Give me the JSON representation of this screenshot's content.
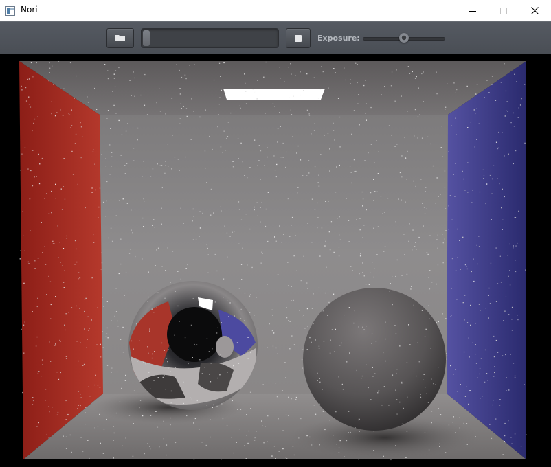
{
  "window": {
    "title": "Nori",
    "app_icon": "window-app-icon",
    "controls": [
      "minimize-icon",
      "maximize-icon",
      "close-icon"
    ]
  },
  "toolbar": {
    "open_button_icon": "folder-icon",
    "render_progress": 0.05,
    "stop_button_icon": "stop-icon",
    "exposure_label": "Exposure:",
    "exposure_value": 0.5
  },
  "scene": {
    "description_icon": "rendered-image",
    "left_wall_color": "#a12a22",
    "right_wall_color": "#3a3a8c",
    "back_wall_color": "#8c8a8a",
    "light_color": "#ffffff"
  }
}
